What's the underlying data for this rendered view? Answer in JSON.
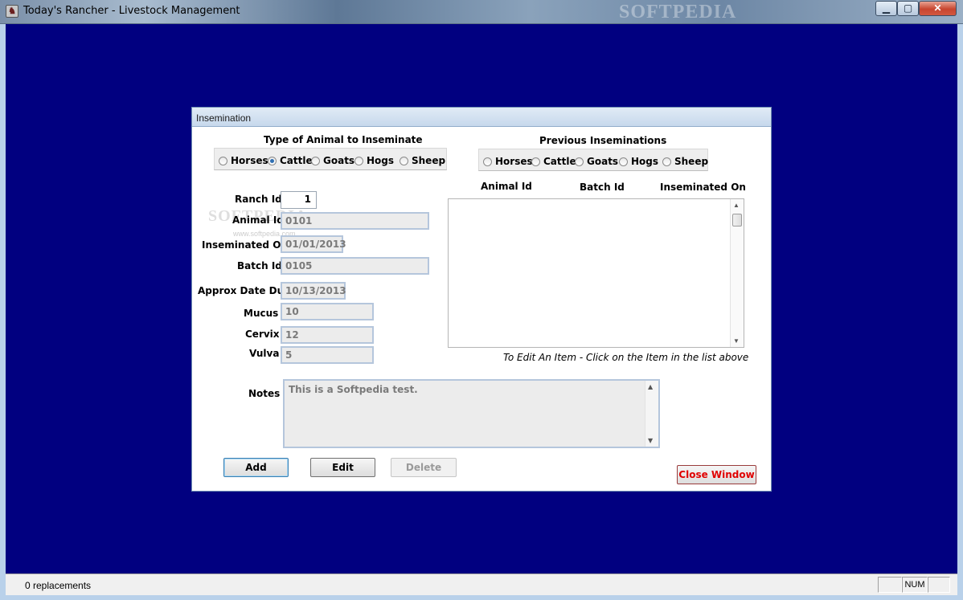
{
  "window": {
    "title": "Today's Rancher - Livestock Management",
    "watermark": "SOFTPEDIA",
    "controls": {
      "minimize": "▁",
      "maximize": "▢",
      "close": "✕"
    }
  },
  "status_bar": {
    "text": "0   replacements",
    "panels": [
      "",
      "NUM",
      ""
    ]
  },
  "dialog": {
    "title": "Insemination",
    "animal_type_group": {
      "title": "Type of Animal to Inseminate",
      "options": [
        "Horses",
        "Cattle",
        "Goats",
        "Hogs",
        "Sheep"
      ],
      "selected": "Cattle"
    },
    "previous_group": {
      "title": "Previous Inseminations",
      "options": [
        "Horses",
        "Cattle",
        "Goats",
        "Hogs",
        "Sheep"
      ],
      "selected": ""
    },
    "fields": {
      "ranch_id": {
        "label": "Ranch Id",
        "value": "1"
      },
      "animal_id": {
        "label": "Animal Id",
        "value": "0101"
      },
      "inseminated_on": {
        "label": "Inseminated On",
        "value": "01/01/2013"
      },
      "batch_id": {
        "label": "Batch Id",
        "value": "0105"
      },
      "approx_date_due": {
        "label": "Approx Date Due",
        "value": "10/13/2013"
      },
      "mucus": {
        "label": "Mucus",
        "value": "10"
      },
      "cervix": {
        "label": "Cervix",
        "value": "12"
      },
      "vulva": {
        "label": "Vulva",
        "value": "5"
      },
      "notes": {
        "label": "Notes",
        "value": "This is a Softpedia test."
      }
    },
    "list": {
      "columns": [
        "Animal Id",
        "Batch Id",
        "Inseminated On"
      ],
      "rows": [],
      "hint": "To Edit An Item - Click on the Item in the list above"
    },
    "buttons": {
      "add": "Add",
      "edit": "Edit",
      "delete": "Delete",
      "close_window": "Close Window"
    },
    "watermark_text": "SOFTPEDIA",
    "watermark_url": "www.softpedia.com"
  }
}
